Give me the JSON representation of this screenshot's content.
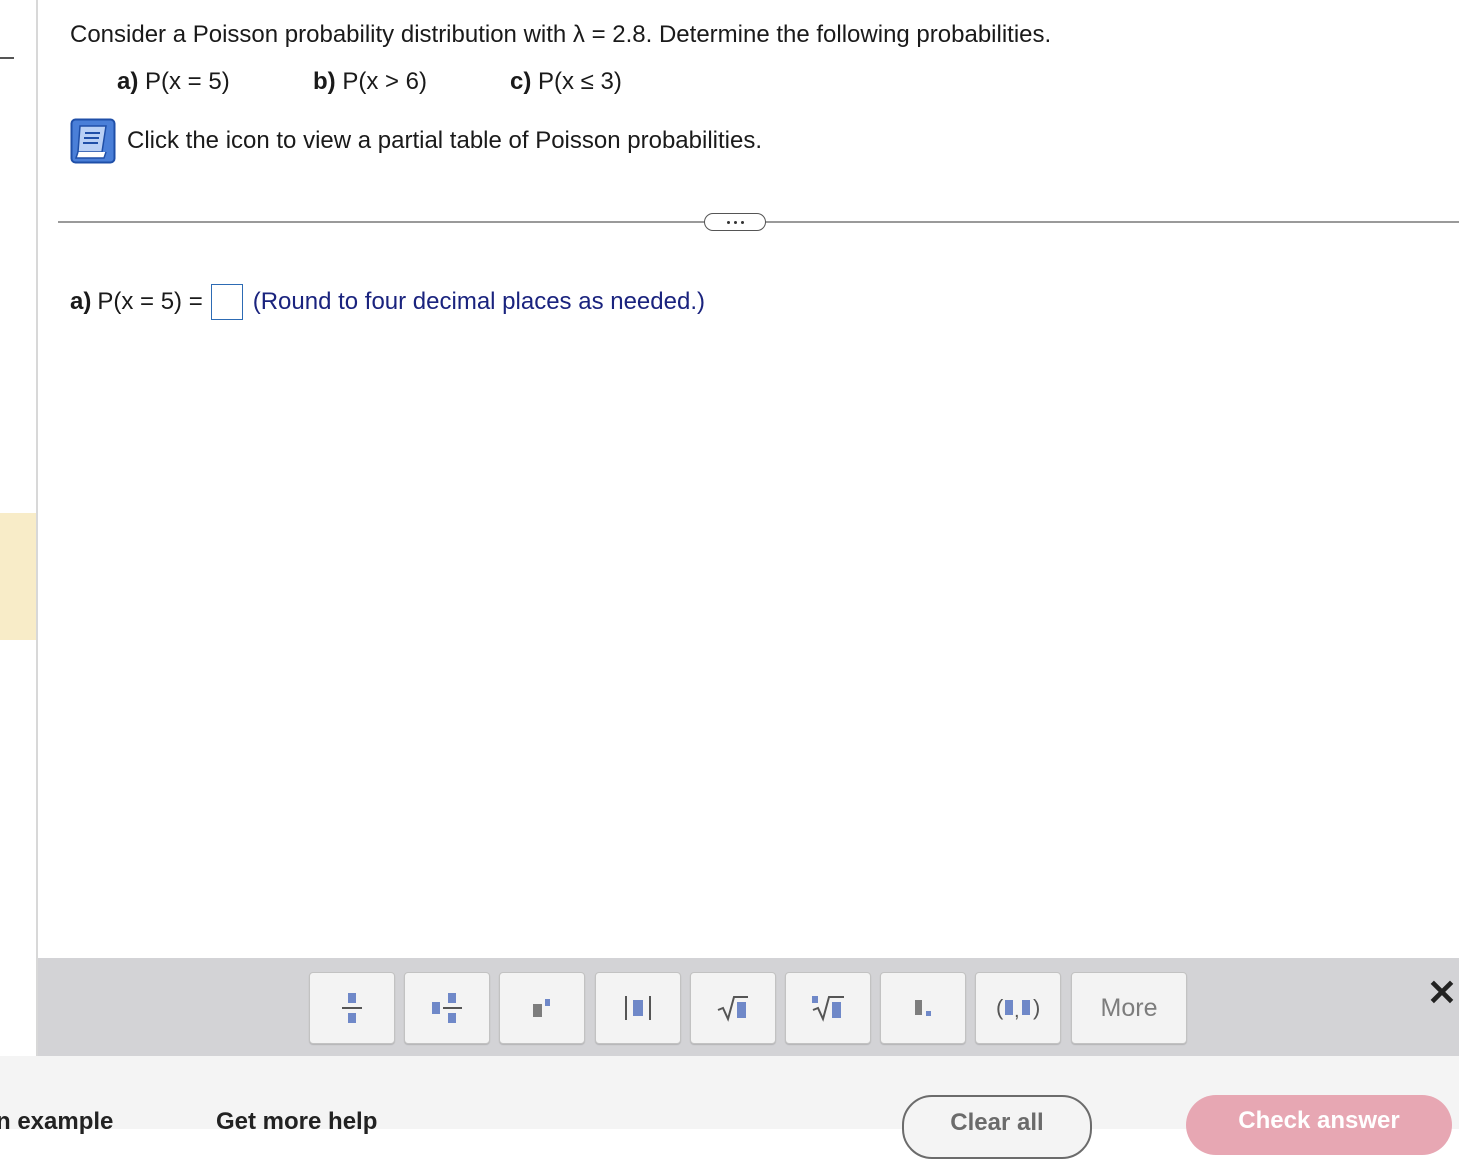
{
  "question": {
    "text": "Consider a Poisson probability distribution with λ = 2.8. Determine the following probabilities.",
    "parts": [
      {
        "label": "a)",
        "expr": "P(x = 5)"
      },
      {
        "label": "b)",
        "expr": "P(x > 6)"
      },
      {
        "label": "c)",
        "expr": "P(x ≤ 3)"
      }
    ],
    "table_link_text": "Click the icon to view a partial table of Poisson probabilities."
  },
  "answer": {
    "label": "a)",
    "expr": "P(x = 5) =",
    "value": "",
    "hint": "(Round to four decimal places as needed.)"
  },
  "toolbar": {
    "buttons": [
      {
        "icon": "fraction-icon",
        "glyph": "▪/▪"
      },
      {
        "icon": "mixed-number-icon",
        "glyph": "▪▪/▪"
      },
      {
        "icon": "exponent-icon",
        "glyph": "▪'"
      },
      {
        "icon": "absolute-value-icon",
        "glyph": "|▪|"
      },
      {
        "icon": "square-root-icon",
        "glyph": "√▪"
      },
      {
        "icon": "nth-root-icon",
        "glyph": "ⁿ√▪"
      },
      {
        "icon": "decimal-icon",
        "glyph": "▪."
      },
      {
        "icon": "ordered-pair-icon",
        "glyph": "(▪,▪)"
      }
    ],
    "more_label": "More",
    "close_glyph": "✕"
  },
  "footer": {
    "similar_example_label": "Help me solve this / View an example",
    "visible_example_fragment": "n example",
    "more_help_label": "Get more help",
    "clear_all_label": "Clear all",
    "check_answer_label": "Check answer"
  },
  "colors": {
    "hint": "#1a237e",
    "answer_box_border": "#2d6bb4",
    "toolbar_bg": "#d3d3d6",
    "check_answer_bg": "#e7a7b3",
    "left_highlight": "#f8ecc8"
  }
}
